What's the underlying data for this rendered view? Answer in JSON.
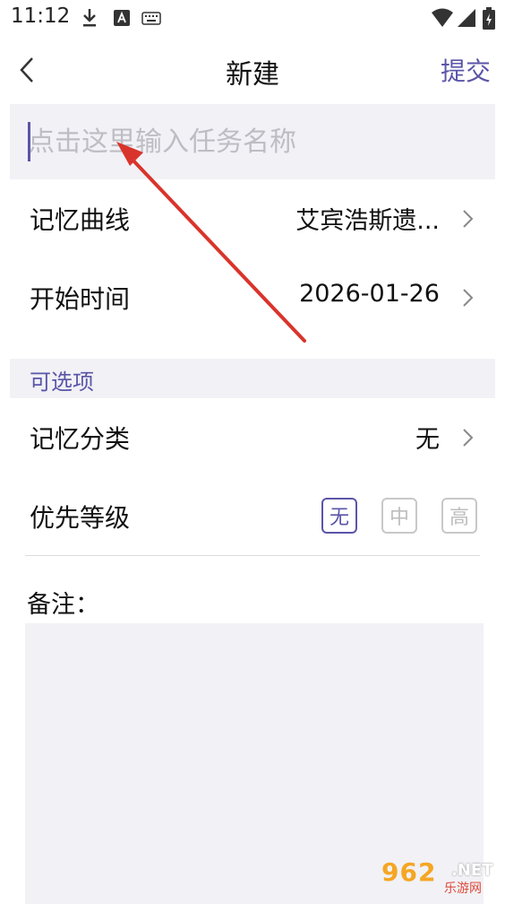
{
  "status_bar": {
    "time": "11:12",
    "icons": [
      "download-icon",
      "a-app-icon",
      "keyboard-icon",
      "wifi-icon",
      "signal-icon",
      "battery-icon"
    ]
  },
  "nav": {
    "title": "新建",
    "submit_label": "提交",
    "back_icon": "chevron-left-icon"
  },
  "task_input": {
    "placeholder": "点击这里输入任务名称",
    "value": ""
  },
  "fields": [
    {
      "label": "记忆曲线",
      "value": "艾宾浩斯遗..."
    },
    {
      "label": "开始时间",
      "value": "2026-01-26"
    }
  ],
  "optional_section": {
    "title": "可选项",
    "category": {
      "label": "记忆分类",
      "value": "无"
    },
    "priority": {
      "label": "优先等级",
      "options": [
        "无",
        "中",
        "高"
      ],
      "selected": "无"
    }
  },
  "notes": {
    "label": "备注：",
    "value": ""
  },
  "watermark": {
    "number": "962",
    "suffix": ".NET",
    "subtitle": "乐游网"
  },
  "colors": {
    "accent": "#5b55a8",
    "input_bg": "#f1f1f6",
    "annotation_arrow": "#d9342b"
  }
}
